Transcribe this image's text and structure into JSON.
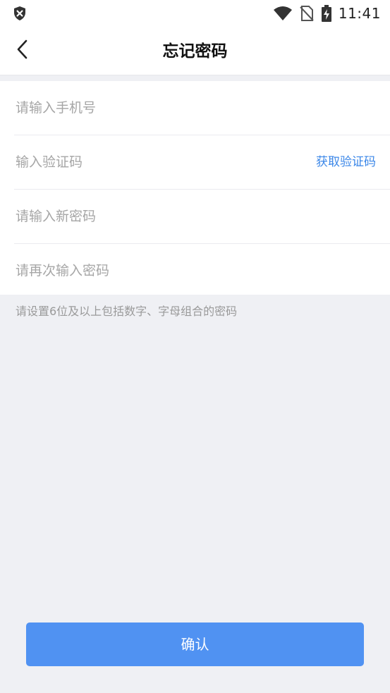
{
  "status_bar": {
    "time": "11:41",
    "icons": [
      "shield-close-icon",
      "wifi-icon",
      "no-sim-icon",
      "battery-charging-icon"
    ]
  },
  "header": {
    "title": "忘记密码",
    "back_icon": "chevron-left-icon"
  },
  "form": {
    "phone_placeholder": "请输入手机号",
    "code_placeholder": "输入验证码",
    "get_code_label": "获取验证码",
    "new_password_placeholder": "请输入新密码",
    "confirm_password_placeholder": "请再次输入密码"
  },
  "hint": "请设置6位及以上包括数字、字母组合的密码",
  "confirm_label": "确认",
  "colors": {
    "accent": "#5092f2",
    "link": "#3b87e8",
    "background": "#eff0f4"
  }
}
